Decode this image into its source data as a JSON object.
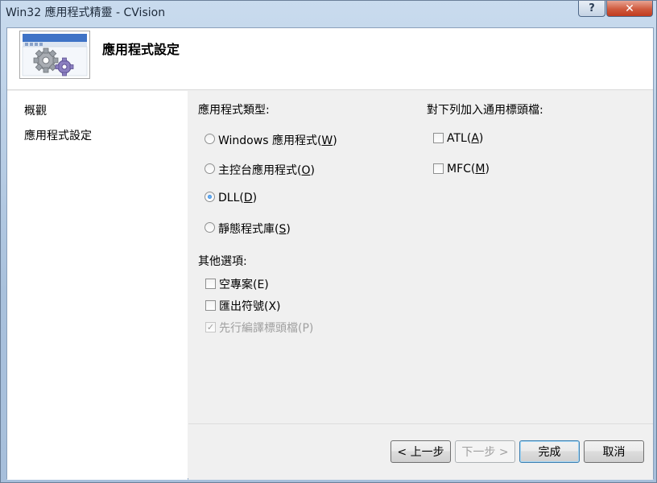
{
  "window": {
    "title": "Win32 應用程式精靈 - CVision",
    "help_glyph": "?",
    "close_glyph": "✕"
  },
  "header": {
    "title": "應用程式設定"
  },
  "sidebar": {
    "items": [
      {
        "label": "概觀"
      },
      {
        "label": "應用程式設定"
      }
    ]
  },
  "app_type": {
    "label": "應用程式類型:",
    "options": [
      {
        "text": "Windows 應用程式(",
        "key": "W",
        "close": ")",
        "checked": false
      },
      {
        "text": "主控台應用程式(",
        "key": "O",
        "close": ")",
        "checked": false
      },
      {
        "text": "DLL(",
        "key": "D",
        "close": ")",
        "checked": true
      },
      {
        "text": "靜態程式庫(",
        "key": "S",
        "close": ")",
        "checked": false
      }
    ]
  },
  "other_options": {
    "label": "其他選項:",
    "items": [
      {
        "text": "空專案(E)",
        "checked": false,
        "enabled": true
      },
      {
        "text": "匯出符號(X)",
        "checked": false,
        "enabled": true
      },
      {
        "text": "先行編譯標頭檔(P)",
        "checked": true,
        "enabled": false
      }
    ]
  },
  "common_headers": {
    "label": "對下列加入通用標頭檔:",
    "items": [
      {
        "text": "ATL(",
        "key": "A",
        "close": ")",
        "checked": false
      },
      {
        "text": "MFC(",
        "key": "M",
        "close": ")",
        "checked": false
      }
    ]
  },
  "buttons": {
    "back": "< 上一步",
    "next": "下一步 >",
    "finish": "完成",
    "cancel": "取消"
  }
}
